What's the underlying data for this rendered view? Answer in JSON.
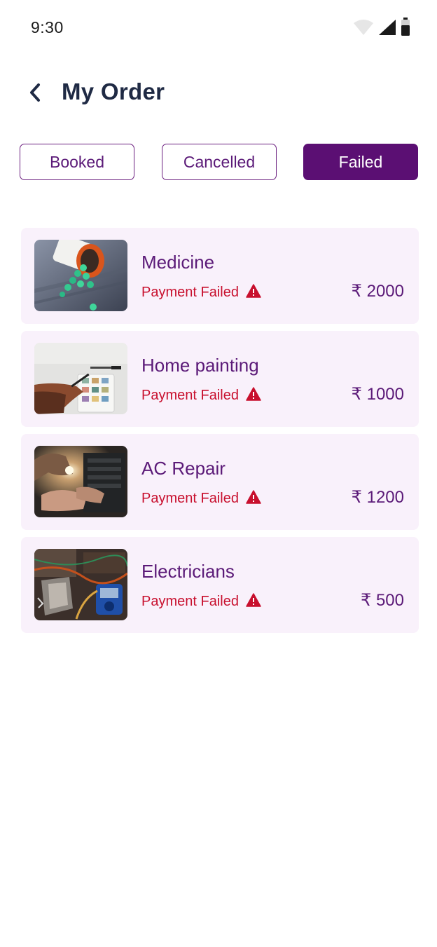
{
  "status_bar": {
    "time": "9:30",
    "icons": [
      "wifi-icon",
      "signal-icon",
      "battery-icon"
    ]
  },
  "header": {
    "back_icon": "chevron-left-icon",
    "title": "My Order"
  },
  "tabs": [
    {
      "label": "Booked",
      "active": false
    },
    {
      "label": "Cancelled",
      "active": false
    },
    {
      "label": "Failed",
      "active": true
    }
  ],
  "orders": [
    {
      "name": "Medicine",
      "status": "Payment Failed",
      "status_icon": "warning-icon",
      "price": "₹ 2000",
      "image": "pill-bottle-photo"
    },
    {
      "name": "Home painting",
      "status": "Payment Failed",
      "status_icon": "warning-icon",
      "price": "₹ 1000",
      "image": "painting-photo"
    },
    {
      "name": "AC Repair",
      "status": "Payment Failed",
      "status_icon": "warning-icon",
      "price": "₹ 1200",
      "image": "ac-repair-photo"
    },
    {
      "name": "Electricians",
      "status": "Payment Failed",
      "status_icon": "warning-icon",
      "price": "₹ 500",
      "image": "electrician-photo"
    }
  ],
  "colors": {
    "brand_purple": "#5b0f73",
    "text_purple": "#5b1a78",
    "card_bg": "#f9f1fb",
    "error_red": "#c8102e",
    "title_navy": "#1f2a44"
  }
}
